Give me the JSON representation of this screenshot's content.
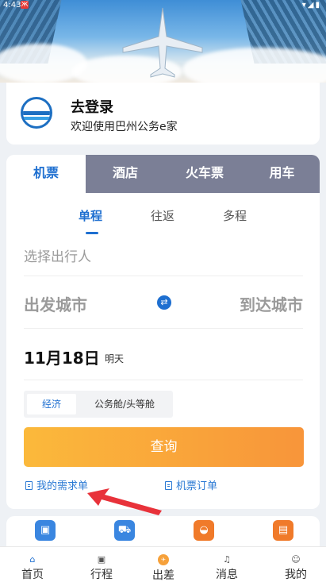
{
  "status_bar": {
    "time": "4:43",
    "notif_badge": "Ж"
  },
  "login": {
    "title": "去登录",
    "subtitle": "欢迎使用巴州公务e家"
  },
  "tabs": [
    {
      "label": "机票",
      "active": true
    },
    {
      "label": "酒店",
      "active": false
    },
    {
      "label": "火车票",
      "active": false
    },
    {
      "label": "用车",
      "active": false
    }
  ],
  "trip_types": [
    {
      "label": "单程",
      "active": true
    },
    {
      "label": "往返",
      "active": false
    },
    {
      "label": "多程",
      "active": false
    }
  ],
  "form": {
    "passenger_placeholder": "选择出行人",
    "from_placeholder": "出发城市",
    "to_placeholder": "到达城市",
    "date": "11月18日",
    "date_relative": "明天",
    "cabin_options": [
      {
        "label": "经济",
        "active": true
      },
      {
        "label": "公务舱/头等舱",
        "active": false
      }
    ],
    "search_label": "查询"
  },
  "links": {
    "my_requests": "我的需求单",
    "flight_orders": "机票订单"
  },
  "services": [
    {
      "icon": "gift-icon",
      "color": "#3a86e0"
    },
    {
      "icon": "cart-icon",
      "color": "#3a86e0"
    },
    {
      "icon": "food-icon",
      "color": "#f07a2a"
    },
    {
      "icon": "bag-icon",
      "color": "#f07a2a"
    }
  ],
  "bottom_nav": [
    {
      "label": "首页",
      "icon": "home-icon",
      "active": true
    },
    {
      "label": "行程",
      "icon": "briefcase-icon",
      "active": false
    },
    {
      "label": "出差",
      "icon": "travel-icon",
      "active": false
    },
    {
      "label": "消息",
      "icon": "bell-icon",
      "active": false
    },
    {
      "label": "我的",
      "icon": "person-icon",
      "active": false
    }
  ],
  "colors": {
    "accent": "#1e6fd0",
    "tab_inactive": "#7b7f96",
    "button_start": "#fbb93b",
    "button_end": "#f8953a"
  }
}
